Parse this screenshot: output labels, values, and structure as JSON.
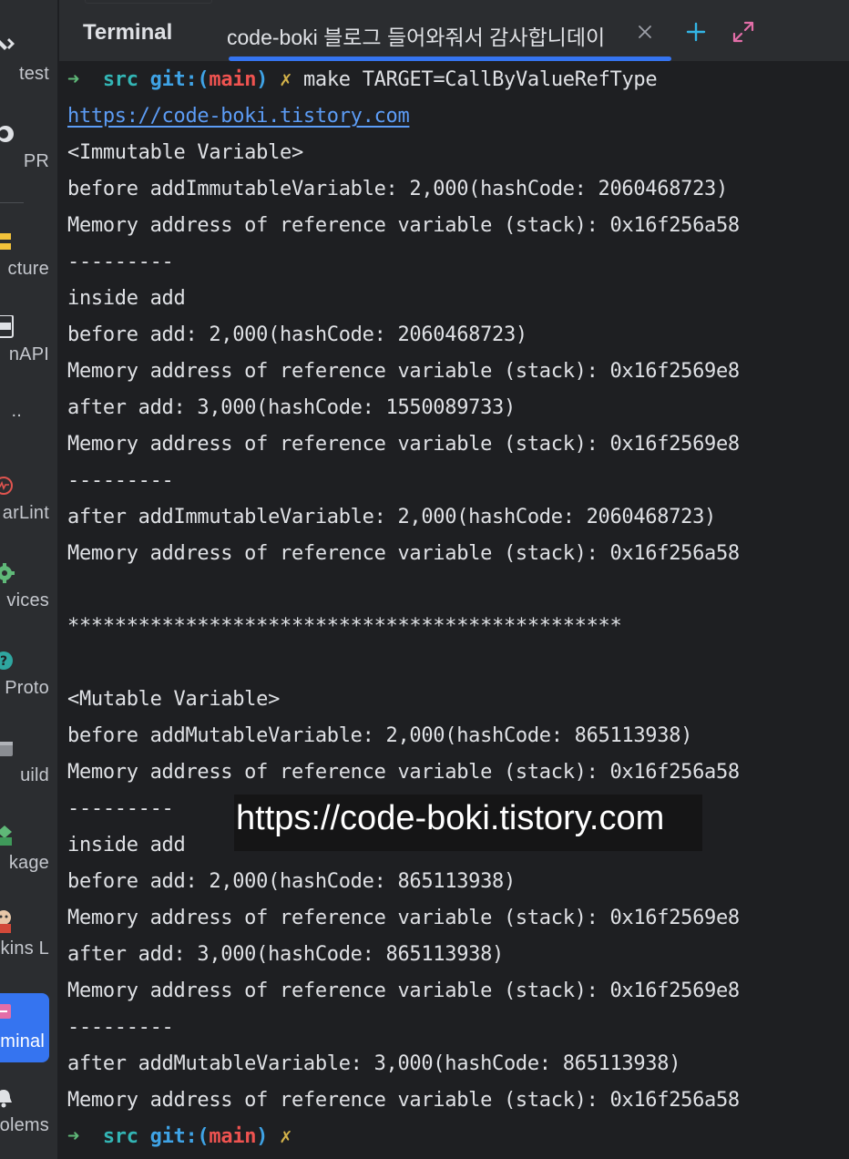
{
  "sidebar": {
    "items": [
      {
        "label": "test",
        "icon": "hammer-icon"
      },
      {
        "label": "PR",
        "icon": "github-icon"
      },
      {
        "label": "cture",
        "icon": "structure-icon"
      },
      {
        "label": "nAPI",
        "icon": "api-icon"
      },
      {
        "label": "..",
        "icon": ""
      },
      {
        "label": "arLint",
        "icon": "sonarlint-icon"
      },
      {
        "label": "vices",
        "icon": "gear-icon"
      },
      {
        "label": "Proto",
        "icon": "help-icon"
      },
      {
        "label": "uild",
        "icon": "build-icon"
      },
      {
        "label": "kage",
        "icon": "package-icon"
      },
      {
        "label": "kins L",
        "icon": "jenkins-icon"
      },
      {
        "label": "minal",
        "icon": "terminal-icon"
      },
      {
        "label": "olems",
        "icon": "bell-icon"
      }
    ]
  },
  "header": {
    "title": "Terminal",
    "tab_label": "code-boki 블로그 들어와줘서 감사합니데이",
    "close_icon": "close-icon",
    "new_tab_icon": "plus-icon",
    "expand_icon": "expand-icon"
  },
  "colors": {
    "accent": "#3574f0",
    "prompt_arrow": "#5fb878",
    "prompt_dir": "#33b5b5",
    "prompt_git": "#3fa3e6",
    "prompt_branch": "#ef5350",
    "prompt_dirty": "#d4b34a",
    "link": "#5c9cf5"
  },
  "terminal": {
    "prompt": {
      "arrow": "➜",
      "dir": "src",
      "git": "git:(",
      "branch": "main",
      "git_close": ")",
      "dirty": "✗"
    },
    "command": "make TARGET=CallByValueRefType",
    "link": "https://code-boki.tistory.com",
    "lines": [
      "<Immutable Variable>",
      "before addImmutableVariable: 2,000(hashCode: 2060468723)",
      "Memory address of reference variable (stack): 0x16f256a58",
      "---------",
      "inside add",
      "before add: 2,000(hashCode: 2060468723)",
      "Memory address of reference variable (stack): 0x16f2569e8",
      "after add: 3,000(hashCode: 1550089733)",
      "Memory address of reference variable (stack): 0x16f2569e8",
      "---------",
      "after addImmutableVariable: 2,000(hashCode: 2060468723)",
      "Memory address of reference variable (stack): 0x16f256a58",
      "",
      "***********************************************",
      "",
      "<Mutable Variable>",
      "before addMutableVariable: 2,000(hashCode: 865113938)",
      "Memory address of reference variable (stack): 0x16f256a58",
      "---------",
      "inside add",
      "before add: 2,000(hashCode: 865113938)",
      "Memory address of reference variable (stack): 0x16f2569e8",
      "after add: 3,000(hashCode: 865113938)",
      "Memory address of reference variable (stack): 0x16f2569e8",
      "---------",
      "after addMutableVariable: 3,000(hashCode: 865113938)",
      "Memory address of reference variable (stack): 0x16f256a58"
    ]
  },
  "watermark": "https://code-boki.tistory.com"
}
